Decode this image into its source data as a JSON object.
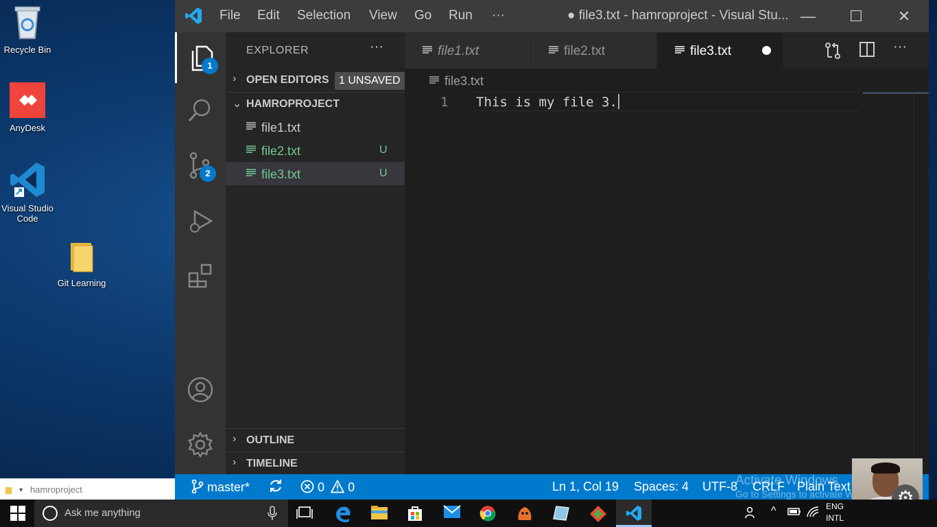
{
  "desktop": {
    "icons": [
      {
        "label": "Recycle Bin"
      },
      {
        "label": "AnyDesk"
      },
      {
        "label": "Visual Studio Code"
      },
      {
        "label": "Git Learning"
      }
    ],
    "explorer_address": "hamroproject"
  },
  "vscode": {
    "menu": [
      "File",
      "Edit",
      "Selection",
      "View",
      "Go",
      "Run",
      "···"
    ],
    "window_title": "● file3.txt - hamroproject - Visual Stu...",
    "activity": {
      "explorer_badge": "1",
      "scm_badge": "2"
    },
    "sidebar": {
      "header": "EXPLORER",
      "more": "···",
      "open_editors": {
        "title": "OPEN EDITORS",
        "badge": "1 UNSAVED",
        "chevron": "›"
      },
      "project": {
        "title": "HAMROPROJECT",
        "chevron": "⌄"
      },
      "files": [
        {
          "name": "file1.txt",
          "status": ""
        },
        {
          "name": "file2.txt",
          "status": "U"
        },
        {
          "name": "file3.txt",
          "status": "U"
        }
      ],
      "outline": {
        "title": "OUTLINE",
        "chevron": "›"
      },
      "timeline": {
        "title": "TIMELINE",
        "chevron": "›"
      }
    },
    "tabs": [
      {
        "label": "file1.txt"
      },
      {
        "label": "file2.txt"
      },
      {
        "label": "file3.txt",
        "dirty": true
      }
    ],
    "tabbar_more": "···",
    "breadcrumb": "file3.txt",
    "editor": {
      "line_number": "1",
      "text": "This is my file 3."
    },
    "statusbar": {
      "branch": "master*",
      "errors": "0",
      "warnings": "0",
      "position": "Ln 1, Col 19",
      "spaces": "Spaces: 4",
      "encoding": "UTF-8",
      "eol": "CRLF",
      "language": "Plain Text"
    }
  },
  "watermark": {
    "line1": "Activate Windows",
    "line2": "Go to Settings to activate Windows."
  },
  "taskbar": {
    "search_placeholder": "Ask me anything",
    "apps": [
      "task-view",
      "edge",
      "file-explorer",
      "store",
      "mail",
      "chrome",
      "app-orange",
      "app-notes",
      "git-gui",
      "vscode"
    ],
    "language": {
      "top": "ENG",
      "bottom": "INTL"
    }
  },
  "colors": {
    "status_bar": "#007acc",
    "untracked": "#73c991",
    "titlebar": "#3c3c3c",
    "sidebar": "#252526",
    "editor": "#1e1e1e"
  }
}
